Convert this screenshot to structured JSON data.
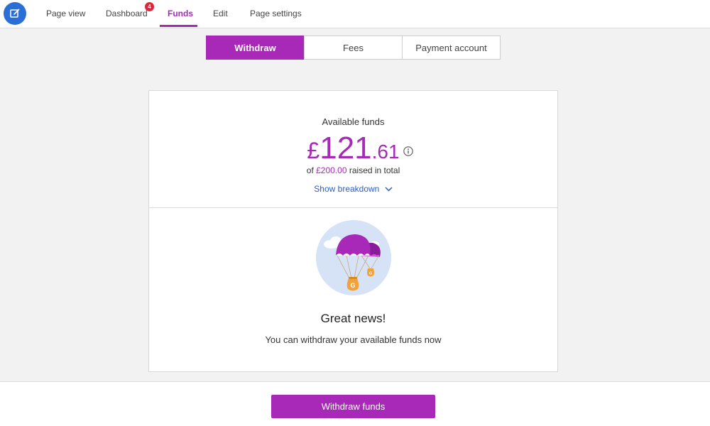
{
  "nav": {
    "items": [
      {
        "label": "Page view"
      },
      {
        "label": "Dashboard",
        "badge": "4"
      },
      {
        "label": "Funds"
      },
      {
        "label": "Edit"
      },
      {
        "label": "Page settings"
      }
    ],
    "active": "Funds",
    "edit_icon": "pencil-square-icon"
  },
  "tabs": {
    "items": [
      {
        "label": "Withdraw"
      },
      {
        "label": "Fees"
      },
      {
        "label": "Payment account"
      }
    ],
    "active": "Withdraw"
  },
  "funds": {
    "label": "Available funds",
    "currency": "£",
    "whole": "121",
    "decimal": ".61",
    "raised_prefix": "of",
    "raised_amount": "£200.00",
    "raised_suffix": "raised in total",
    "breakdown_link": "Show breakdown"
  },
  "message": {
    "title": "Great news!",
    "body": "You can withdraw your available funds now"
  },
  "footer": {
    "button_label": "Withdraw funds"
  },
  "colors": {
    "accent": "#a828b8",
    "link": "#2c5dbf",
    "badge": "#e0263b",
    "edit_button": "#2a6fd6"
  }
}
